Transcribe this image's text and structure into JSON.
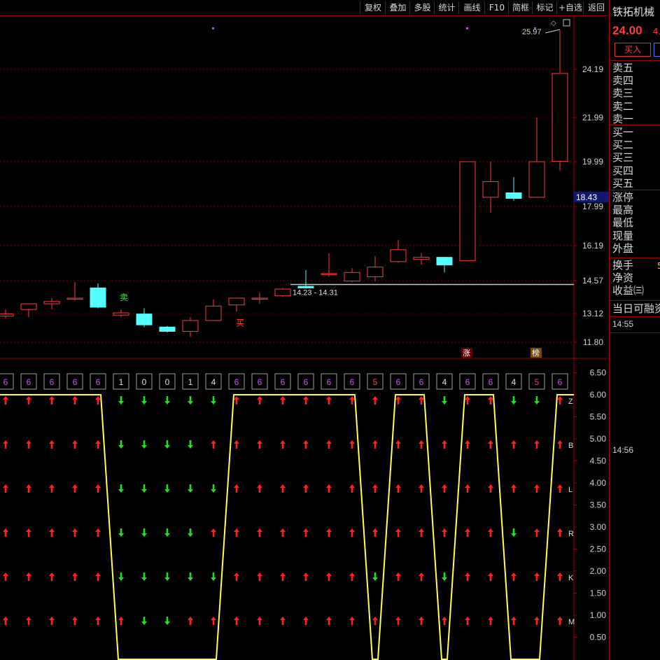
{
  "toolbar": [
    "复权",
    "叠加",
    "多股",
    "统计",
    "画线",
    "F10",
    "简框",
    "标记",
    "+自选",
    "返回"
  ],
  "stock": {
    "name": "铁拓机械",
    "price": "24.00",
    "change": "4.",
    "buy_button": "买入",
    "ask_labels": [
      "卖五",
      "卖四",
      "卖三",
      "卖二",
      "卖一"
    ],
    "bid_labels": [
      "买一",
      "买二",
      "买三",
      "买四",
      "买五"
    ],
    "stat_labels": [
      "涨停",
      "最高",
      "最低",
      "现量",
      "外盘"
    ],
    "extra_labels": [
      "换手",
      "净资",
      "收益㈢"
    ],
    "extra_digit": "5",
    "margin_label": "当日可融资",
    "times": [
      "14:55",
      "14:56"
    ]
  },
  "colors": {
    "up": "#ff3b3b",
    "down": "#54ffff",
    "yellow": "#ffff55",
    "green": "#00e000",
    "grid": "#7a0000",
    "axis": "#a00000"
  },
  "chart_data": [
    {
      "type": "candlestick",
      "y_ticks": [
        "24.19",
        "21.99",
        "19.99",
        "17.99",
        "16.19",
        "14.57",
        "13.12",
        "11.80"
      ],
      "current_price_tag": "18.43",
      "peak_label": "25.97",
      "range_label": "14.23 - 14.31",
      "signal_sell": "卖",
      "signal_buy": "买",
      "event_tags": [
        "涨",
        "榜"
      ],
      "candles": [
        {
          "o": 13.0,
          "h": 13.3,
          "l": 12.9,
          "c": 13.1
        },
        {
          "o": 13.3,
          "h": 13.5,
          "l": 12.95,
          "c": 13.55
        },
        {
          "o": 13.55,
          "h": 13.8,
          "l": 13.3,
          "c": 13.65
        },
        {
          "o": 13.75,
          "h": 14.5,
          "l": 13.7,
          "c": 13.8
        },
        {
          "o": 14.25,
          "h": 14.45,
          "l": 13.35,
          "c": 13.4
        },
        {
          "o": 13.05,
          "h": 13.3,
          "l": 12.95,
          "c": 13.15
        },
        {
          "o": 13.1,
          "h": 13.35,
          "l": 12.5,
          "c": 12.6
        },
        {
          "o": 12.5,
          "h": 12.55,
          "l": 12.25,
          "c": 12.3
        },
        {
          "o": 12.3,
          "h": 12.95,
          "l": 12.05,
          "c": 12.8
        },
        {
          "o": 12.8,
          "h": 13.75,
          "l": 12.8,
          "c": 13.45
        },
        {
          "o": 13.5,
          "h": 13.7,
          "l": 13.2,
          "c": 13.8
        },
        {
          "o": 13.8,
          "h": 14.05,
          "l": 13.55,
          "c": 13.8
        },
        {
          "o": 13.9,
          "h": 14.25,
          "l": 13.85,
          "c": 14.2
        },
        {
          "o": 14.32,
          "h": 15.05,
          "l": 14.23,
          "c": 14.25
        },
        {
          "o": 14.9,
          "h": 15.85,
          "l": 14.75,
          "c": 14.9
        },
        {
          "o": 14.55,
          "h": 15.15,
          "l": 14.5,
          "c": 14.95
        },
        {
          "o": 14.75,
          "h": 15.7,
          "l": 14.55,
          "c": 15.2
        },
        {
          "o": 15.45,
          "h": 16.45,
          "l": 15.4,
          "c": 16.0
        },
        {
          "o": 15.55,
          "h": 15.85,
          "l": 15.3,
          "c": 15.65
        },
        {
          "o": 15.65,
          "h": 15.65,
          "l": 14.95,
          "c": 15.3
        },
        {
          "o": 15.5,
          "h": 19.99,
          "l": 15.5,
          "c": 19.99
        },
        {
          "o": 18.4,
          "h": 19.99,
          "l": 17.7,
          "c": 19.1
        },
        {
          "o": 18.6,
          "h": 19.3,
          "l": 18.25,
          "c": 18.35
        },
        {
          "o": 18.4,
          "h": 21.99,
          "l": 18.4,
          "c": 19.99
        },
        {
          "o": 20.0,
          "h": 25.97,
          "l": 19.6,
          "c": 24.0
        }
      ]
    },
    {
      "type": "line",
      "y_ticks": [
        "6.50",
        "6.00",
        "5.50",
        "5.00",
        "4.50",
        "4.00",
        "3.50",
        "3.00",
        "2.50",
        "2.00",
        "1.50",
        "1.00",
        "0.50"
      ],
      "ylim": [
        0,
        6.5
      ],
      "side_letters": [
        "Z",
        "B",
        "L",
        "R",
        "K",
        "M"
      ],
      "values": [
        6,
        6,
        6,
        6,
        6,
        1,
        0,
        0,
        1,
        4,
        6,
        6,
        6,
        6,
        6,
        6,
        5,
        6,
        6,
        4,
        6,
        6,
        4,
        5,
        6
      ],
      "line_values": [
        6,
        6,
        6,
        6,
        6,
        0,
        0,
        0,
        0,
        0,
        6,
        6,
        6,
        6,
        6,
        6,
        0,
        6,
        6,
        0,
        6,
        6,
        0,
        0,
        6
      ],
      "arrow_rows": [
        {
          "letter": "Z",
          "dirs": [
            "up",
            "up",
            "up",
            "up",
            "up",
            "down",
            "down",
            "down",
            "down",
            "down",
            "up",
            "up",
            "up",
            "up",
            "up",
            "up",
            "up",
            "up",
            "up",
            "down",
            "up",
            "up",
            "down",
            "down",
            "up"
          ]
        },
        {
          "letter": "B",
          "dirs": [
            "up",
            "up",
            "up",
            "up",
            "up",
            "down",
            "down",
            "down",
            "down",
            "up",
            "up",
            "up",
            "up",
            "up",
            "up",
            "up",
            "up",
            "up",
            "up",
            "up",
            "up",
            "up",
            "up",
            "up",
            "up"
          ]
        },
        {
          "letter": "L",
          "dirs": [
            "up",
            "up",
            "up",
            "up",
            "up",
            "down",
            "down",
            "down",
            "down",
            "down",
            "up",
            "up",
            "up",
            "up",
            "up",
            "up",
            "up",
            "up",
            "up",
            "up",
            "up",
            "up",
            "up",
            "up",
            "up"
          ]
        },
        {
          "letter": "R",
          "dirs": [
            "up",
            "up",
            "up",
            "up",
            "up",
            "down",
            "down",
            "down",
            "down",
            "up",
            "up",
            "up",
            "up",
            "up",
            "up",
            "up",
            "up",
            "up",
            "up",
            "up",
            "up",
            "up",
            "down",
            "up",
            "up"
          ]
        },
        {
          "letter": "K",
          "dirs": [
            "up",
            "up",
            "up",
            "up",
            "up",
            "down",
            "down",
            "down",
            "down",
            "down",
            "up",
            "up",
            "up",
            "up",
            "up",
            "up",
            "down",
            "up",
            "up",
            "down",
            "up",
            "up",
            "up",
            "up",
            "up"
          ]
        },
        {
          "letter": "M",
          "dirs": [
            "up",
            "up",
            "up",
            "up",
            "up",
            "up",
            "down",
            "down",
            "up",
            "up",
            "up",
            "up",
            "up",
            "up",
            "up",
            "up",
            "up",
            "up",
            "up",
            "up",
            "up",
            "up",
            "up",
            "up",
            "up"
          ]
        }
      ]
    }
  ]
}
